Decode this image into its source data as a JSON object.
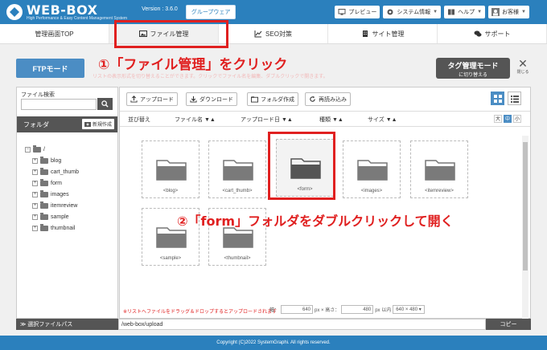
{
  "header": {
    "logo_title": "WEB-BOX",
    "logo_sub": "High Performance & Easy Content Management System",
    "version": "Version : 3.6.0",
    "group_button": "グループウェア",
    "preview": "プレビュー",
    "system_info": "システム情報",
    "help": "ヘルプ",
    "user": "お客様"
  },
  "nav": {
    "items": [
      {
        "label": "管理画面TOP"
      },
      {
        "label": "ファイル管理"
      },
      {
        "label": "SEO対策"
      },
      {
        "label": "サイト管理"
      },
      {
        "label": "サポート"
      }
    ]
  },
  "annotations": {
    "step1": "①「ファイル管理」をクリック",
    "step2": "②「form」フォルダをダブルクリックして開く"
  },
  "ftp": {
    "button": "FTPモード",
    "note": "リストの表示形式を切り替えることができます。クリックでファイル名を編集、ダブルクリックで開きます。"
  },
  "tag_mode": {
    "line1": "タグ管理モード",
    "line2": "に切り替える"
  },
  "close": {
    "label": "閉じる"
  },
  "left": {
    "search_label": "ファイル検索",
    "folder_label": "フォルダ",
    "new_folder": "新規作成",
    "root": "/",
    "tree": [
      "blog",
      "cart_thumb",
      "form",
      "images",
      "itemreview",
      "sample",
      "thumbnail"
    ]
  },
  "toolbar": {
    "upload": "アップロード",
    "download": "ダウンロード",
    "new_folder": "フォルダ作成",
    "reload": "再読み込み"
  },
  "sortbar": {
    "sort": "並び替え",
    "filename": "ファイル名 ▼▲",
    "date": "アップロード日 ▼▲",
    "kind": "種類 ▼▲",
    "size": "サイズ ▼▲",
    "sizes": [
      "大",
      "中",
      "小"
    ]
  },
  "files": [
    "<blog>",
    "<cart_thumb>",
    "<form>",
    "<images>",
    "<itemreview>",
    "<sample>",
    "<thumbnail>"
  ],
  "bottom": {
    "note": "※リストへファイルをドラッグ＆ドロップするとアップロードされます",
    "width_label": "幅：",
    "width_value": "640",
    "height_label": "px × 高さ：",
    "height_value": "480",
    "unit": "px 以内",
    "preset": "640 × 480"
  },
  "path": {
    "label": "≫ 選択ファイルパス",
    "value": "/web-box/upload",
    "copy": "コピー"
  },
  "footer": "Copyright (C)2022 SystemGraphi. All rights reserved.",
  "colors": {
    "header": "#2b80bd",
    "accent": "#4b8dc4",
    "highlight": "#e02020"
  }
}
